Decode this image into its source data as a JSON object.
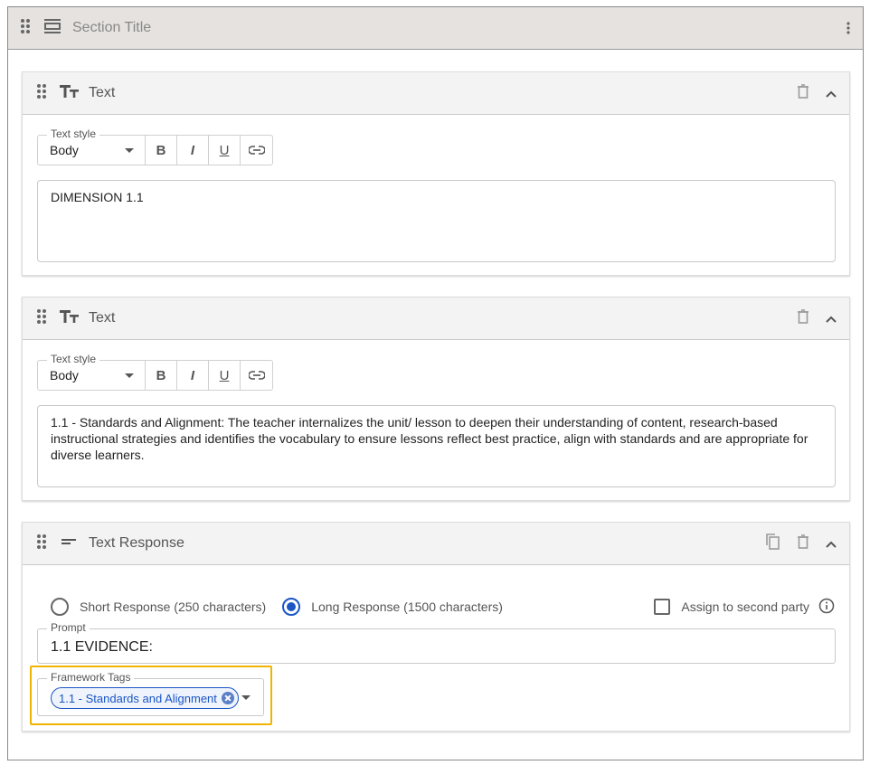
{
  "section": {
    "title": "Section Title"
  },
  "cards": [
    {
      "title": "Text",
      "text_style_label": "Text style",
      "text_style_value": "Body",
      "content": "DIMENSION 1.1"
    },
    {
      "title": "Text",
      "text_style_label": "Text style",
      "text_style_value": "Body",
      "content": "1.1 - Standards and Alignment: The teacher internalizes the unit/ lesson to deepen their understanding of content, research-based instructional strategies and identifies the vocabulary to ensure lessons reflect best practice, align with standards and are appropriate for diverse learners."
    }
  ],
  "response_card": {
    "title": "Text Response",
    "short_label": "Short Response (250 characters)",
    "long_label": "Long Response (1500 characters)",
    "selected": "long",
    "second_party_label": "Assign to second party",
    "prompt_label": "Prompt",
    "prompt_value": "1.1 EVIDENCE:",
    "tags_label": "Framework Tags",
    "tags": [
      "1.1 - Standards and Alignment"
    ]
  },
  "toolbar": {
    "bold": "B",
    "italic": "I",
    "underline": "U"
  },
  "colors": {
    "accent": "#1a56c4",
    "highlight": "#f0b400",
    "section_header_bg": "#e5e2df"
  }
}
